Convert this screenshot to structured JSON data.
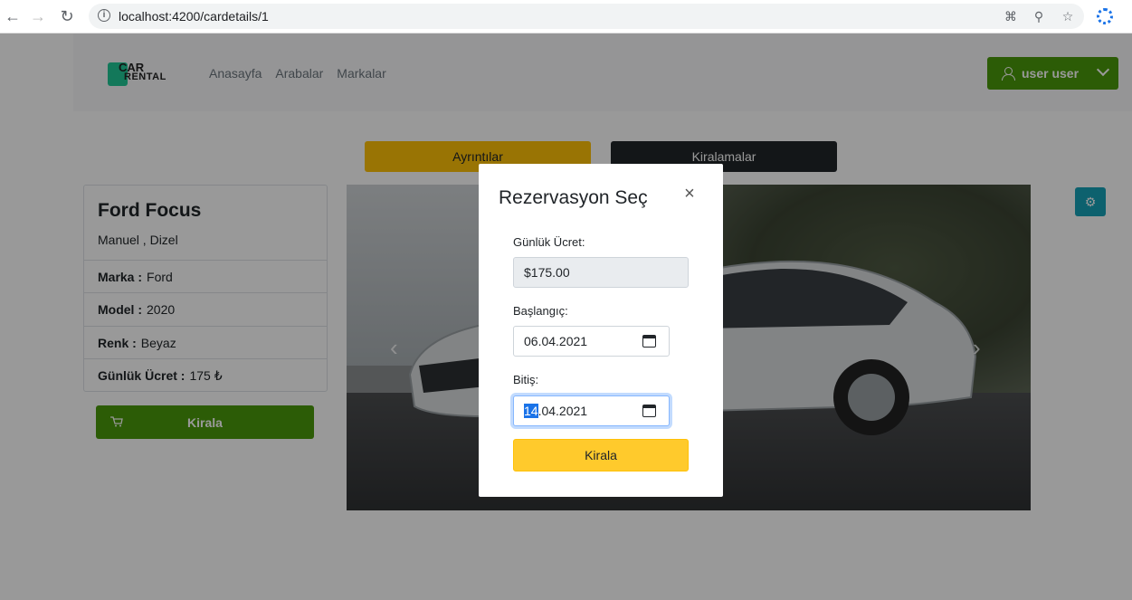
{
  "browser": {
    "url": "localhost:4200/cardetails/1"
  },
  "navbar": {
    "logo_line1": "CAR",
    "logo_line2": "RENTAL",
    "links": [
      "Anasayfa",
      "Arabalar",
      "Markalar"
    ],
    "user_label": "user user"
  },
  "tabs": {
    "details": "Ayrıntılar",
    "rentals": "Kiralamalar"
  },
  "car": {
    "title": "Ford Focus",
    "subtitle": "Manuel , Dizel",
    "brand_label": "Marka :",
    "brand": "Ford",
    "model_label": "Model :",
    "model": "2020",
    "color_label": "Renk :",
    "color": "Beyaz",
    "price_label": "Günlük Ücret :",
    "price": "175 ₺",
    "rent_button": "Kirala"
  },
  "modal": {
    "title": "Rezervasyon Seç",
    "daily_label": "Günlük Ücret:",
    "daily_value": "$175.00",
    "start_label": "Başlangıç:",
    "start_value": "06.04.2021",
    "end_label": "Bitiş:",
    "end_day": "14",
    "end_rest": ".04.2021",
    "submit": "Kirala"
  },
  "colors": {
    "primary_green": "#4a9a0a",
    "warning": "#ffc107",
    "dark": "#212529",
    "info": "#17a2b8"
  },
  "icons": [
    "back-arrow-icon",
    "forward-arrow-icon",
    "reload-icon",
    "info-icon",
    "translate-icon",
    "zoom-icon",
    "star-icon",
    "extension-icon",
    "user-icon",
    "chevron-down-icon",
    "cart-icon",
    "gear-icon",
    "close-icon",
    "calendar-icon"
  ]
}
